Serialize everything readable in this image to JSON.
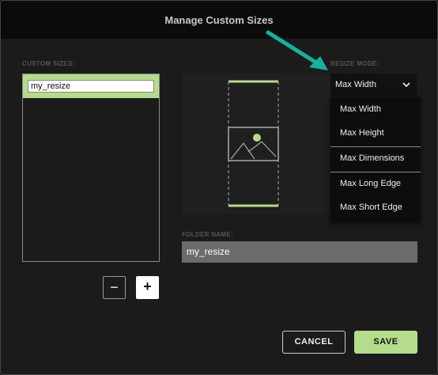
{
  "dialog": {
    "title": "Manage Custom Sizes"
  },
  "custom_sizes": {
    "label": "CUSTOM SIZES:",
    "items": [
      {
        "label": "my_resize",
        "selected": true
      }
    ],
    "remove_button": "−",
    "add_button": "+"
  },
  "resize_mode": {
    "label": "RESIZE MODE:",
    "selected": "Max Width",
    "options": [
      "Max Width",
      "Max Height",
      "Max Dimensions",
      "Max Long Edge",
      "Max Short Edge"
    ]
  },
  "folder": {
    "label": "FOLDER NAME:",
    "value": "my_resize"
  },
  "footer": {
    "cancel_label": "CANCEL",
    "save_label": "SAVE"
  },
  "colors": {
    "accent": "#b5dc8a",
    "annotation_arrow": "#14b39a"
  },
  "icons": {
    "dropdown": "chevron-down-icon",
    "preview": "image-placeholder-icon",
    "annotation": "arrow-icon"
  }
}
